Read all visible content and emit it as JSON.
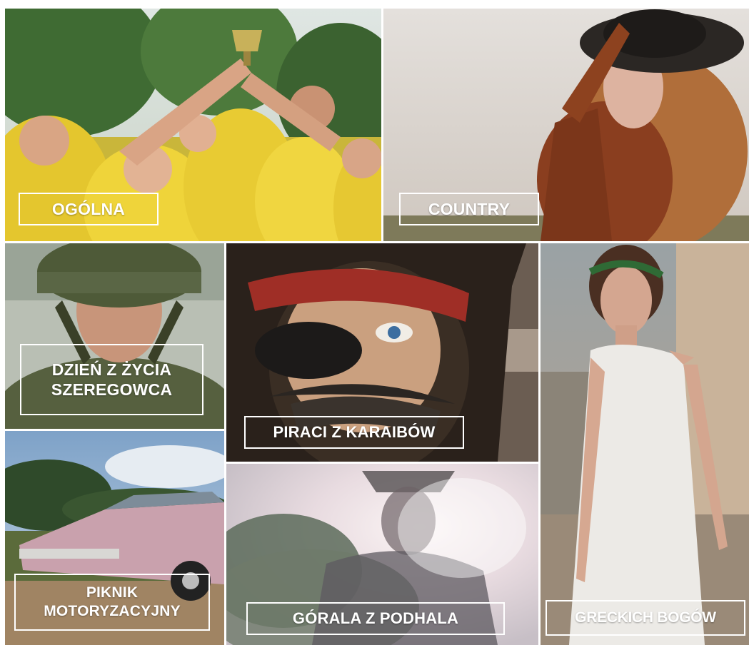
{
  "categories": [
    {
      "label_lines": [
        "OGÓLNA"
      ],
      "photo": "team-raising-trophy-photo"
    },
    {
      "label_lines": [
        "COUNTRY"
      ],
      "photo": "woman-with-hat-country-photo"
    },
    {
      "label_lines": [
        "DZIEŃ Z ŻYCIA",
        "SZEREGOWCA"
      ],
      "photo": "soldier-in-helmet-photo"
    },
    {
      "label_lines": [
        "PIRACI Z KARAIBÓW"
      ],
      "photo": "pirate-with-eyepatch-photo"
    },
    {
      "label_lines": [
        "GRECKICH BOGÓW"
      ],
      "photo": "woman-in-greek-dress-photo"
    },
    {
      "label_lines": [
        "PIKNIK",
        "MOTORYZACYJNY"
      ],
      "photo": "vintage-pink-car-photo"
    },
    {
      "label_lines": [
        "GÓRALA Z PODHALA"
      ],
      "photo": "man-in-hat-sunlight-photo"
    }
  ],
  "colors": {
    "label_border": "#ffffff",
    "label_text": "#ffffff",
    "background": "#ffffff"
  }
}
